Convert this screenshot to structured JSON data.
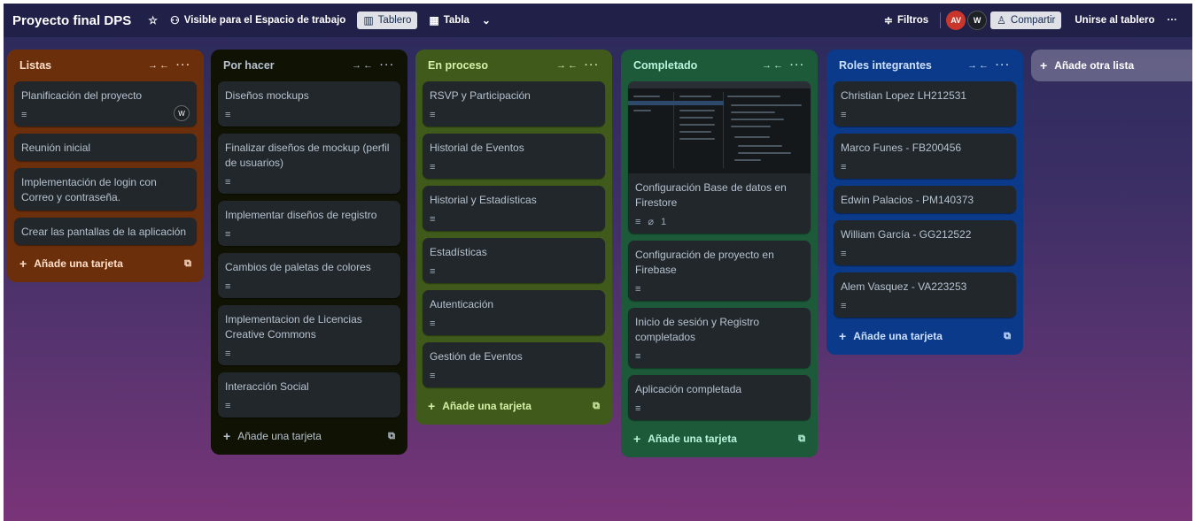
{
  "header": {
    "board_title": "Proyecto final DPS",
    "visibility": "Visible para el Espacio de trabajo",
    "view_board": "Tablero",
    "view_table": "Tabla",
    "filters": "Filtros",
    "avatar1": "AV",
    "avatar2": "W",
    "share": "Compartir",
    "join": "Unirse al tablero"
  },
  "lists": {
    "listas": {
      "title": "Listas",
      "cards": [
        "Planificación del proyecto",
        "Reunión inicial",
        "Implementación de login con Correo y contraseña.",
        "Crear las pantallas de la aplicación"
      ],
      "card0_avatar": "W",
      "add": "Añade una tarjeta"
    },
    "porhacer": {
      "title": "Por hacer",
      "cards": [
        "Diseños mockups",
        "Finalizar diseños de mockup (perfil de usuarios)",
        "Implementar diseños de registro",
        "Cambios de paletas de colores",
        "Implementacion de Licencias Creative Commons",
        "Interacción Social"
      ],
      "add": "Añade una tarjeta"
    },
    "proceso": {
      "title": "En proceso",
      "cards": [
        "RSVP y Participación",
        "Historial de Eventos",
        "Historial y Estadísticas",
        "Estadísticas",
        "Autenticación",
        "Gestión de Eventos"
      ],
      "add": "Añade una tarjeta"
    },
    "completado": {
      "title": "Completado",
      "cards": [
        "Configuración Base de datos en Firestore",
        "Configuración de proyecto en Firebase",
        "Inicio de sesión y Registro completados",
        "Aplicación completada"
      ],
      "attachments": "1",
      "add": "Añade una tarjeta"
    },
    "roles": {
      "title": "Roles integrantes",
      "cards": [
        "Christian Lopez LH212531",
        "Marco Funes - FB200456",
        "Edwin Palacios - PM140373",
        "William García - GG212522",
        "Alem Vasquez - VA223253"
      ],
      "add": "Añade una tarjeta"
    }
  },
  "add_list": "Añade otra lista"
}
